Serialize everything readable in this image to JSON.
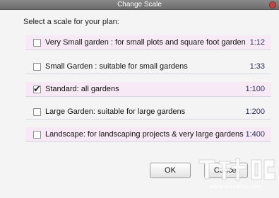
{
  "window": {
    "title": "Change Scale"
  },
  "prompt": "Select a scale for your plan:",
  "options": [
    {
      "label": "Very Small garden : for small plots and square foot garden",
      "scale": "1:12",
      "checked": false
    },
    {
      "label": "Small Garden : suitable for small gardens",
      "scale": "1:33",
      "checked": false
    },
    {
      "label": "Standard: all gardens",
      "scale": "1:100",
      "checked": true
    },
    {
      "label": "Large Garden: suitable for large gardens",
      "scale": "1:200",
      "checked": false
    },
    {
      "label": "Landscape: for landscaping projects & very large gardens",
      "scale": "1:400",
      "checked": false
    }
  ],
  "buttons": {
    "ok": "OK",
    "cancel": "Cancel"
  },
  "watermark": {
    "text": "www.xiazaiba.com"
  },
  "colors": {
    "row_highlight": "#f7e9f5",
    "titlebar": "#7a7a7a",
    "scale_text": "#2a2f55"
  }
}
